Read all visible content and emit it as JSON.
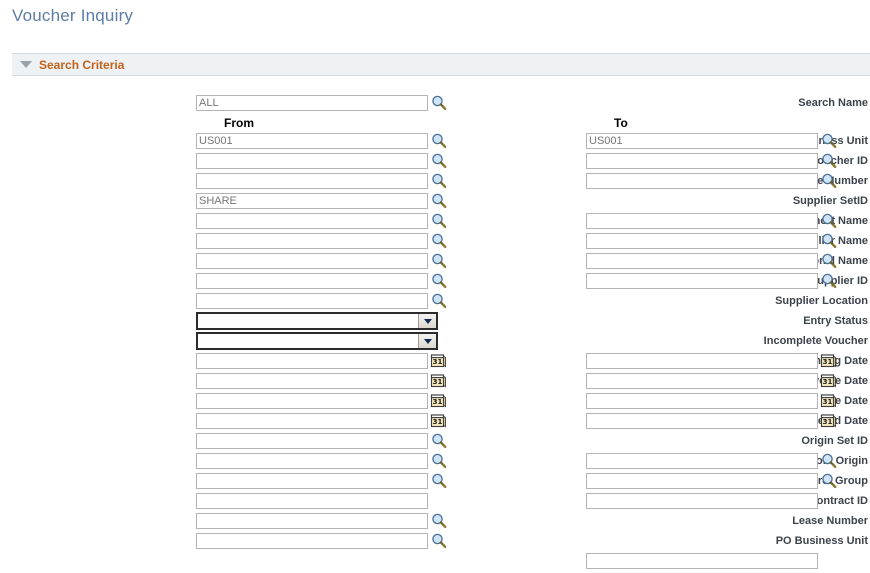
{
  "page": {
    "title": "Voucher Inquiry"
  },
  "criteria_section": {
    "header_label": "Search Criteria",
    "collapse_icon": "triangle-down-icon",
    "expanded": true
  },
  "search_name": {
    "label": "Search Name",
    "value": "ALL",
    "lookup_icon": "magnifier-icon"
  },
  "column_headers": {
    "from": "From",
    "to": "To"
  },
  "icons": {
    "lookup": "magnifier-icon",
    "calendar": "calendar-icon",
    "dropdown": "chevron-down-icon"
  },
  "colors": {
    "title": "#5b7da6",
    "section_header_text": "#c4611a",
    "section_header_bg": "#eff2f5",
    "label_text": "#3c434b",
    "field_border": "#b4b4b4",
    "field_value_text": "#777777",
    "calendar_icon": "#e8d9a8"
  },
  "fields": [
    {
      "label": "From Business Unit",
      "from": {
        "value": "US001",
        "icon": "magnifier-icon"
      },
      "to": {
        "value": "US001",
        "icon": "magnifier-icon"
      }
    },
    {
      "label": "From Voucher ID",
      "from": {
        "value": "",
        "icon": "magnifier-icon"
      },
      "to": {
        "value": "",
        "icon": "magnifier-icon"
      }
    },
    {
      "label": "From Invoice Number",
      "from": {
        "value": "",
        "icon": "magnifier-icon"
      },
      "to": {
        "value": "",
        "icon": "magnifier-icon"
      }
    },
    {
      "label": "Supplier SetID",
      "from": {
        "value": "SHARE",
        "icon": "magnifier-icon"
      },
      "to": null
    },
    {
      "label": "From Supplier Short Name",
      "from": {
        "value": "",
        "icon": "magnifier-icon"
      },
      "to": {
        "value": "",
        "icon": "magnifier-icon"
      }
    },
    {
      "label": "From Supplier Name",
      "from": {
        "value": "",
        "icon": "magnifier-icon"
      },
      "to": {
        "value": "",
        "icon": "magnifier-icon"
      }
    },
    {
      "label": "From Additional Name",
      "from": {
        "value": "",
        "icon": "magnifier-icon"
      },
      "to": {
        "value": "",
        "icon": "magnifier-icon"
      }
    },
    {
      "label": "From Supplier ID",
      "from": {
        "value": "",
        "icon": "magnifier-icon"
      },
      "to": {
        "value": "",
        "icon": "magnifier-icon"
      }
    },
    {
      "label": "Supplier Location",
      "from": {
        "value": "",
        "icon": "magnifier-icon"
      },
      "to": null
    },
    {
      "label": "Entry Status",
      "from": {
        "value": "",
        "icon": "chevron-down-icon",
        "control": "select"
      },
      "to": null
    },
    {
      "label": "Incomplete Voucher",
      "from": {
        "value": "",
        "icon": "chevron-down-icon",
        "control": "select"
      },
      "to": null
    },
    {
      "label": "From Accounting Date",
      "from": {
        "value": "",
        "icon": "calendar-icon"
      },
      "to": {
        "value": "",
        "icon": "calendar-icon"
      }
    },
    {
      "label": "From Invoice Date",
      "from": {
        "value": "",
        "icon": "calendar-icon"
      },
      "to": {
        "value": "",
        "icon": "calendar-icon"
      }
    },
    {
      "label": "From Due Date",
      "from": {
        "value": "",
        "icon": "calendar-icon"
      },
      "to": {
        "value": "",
        "icon": "calendar-icon"
      }
    },
    {
      "label": "From Entered Date",
      "from": {
        "value": "",
        "icon": "calendar-icon"
      },
      "to": {
        "value": "",
        "icon": "calendar-icon"
      }
    },
    {
      "label": "Origin Set ID",
      "from": {
        "value": "",
        "icon": "magnifier-icon"
      },
      "to": null
    },
    {
      "label": "From Origin",
      "from": {
        "value": "",
        "icon": "magnifier-icon"
      },
      "to": {
        "value": "",
        "icon": "magnifier-icon"
      }
    },
    {
      "label": "From Control Group",
      "from": {
        "value": "",
        "icon": "magnifier-icon"
      },
      "to": {
        "value": "",
        "icon": "magnifier-icon"
      }
    },
    {
      "label": "From Contract ID",
      "from": {
        "value": "",
        "icon": null
      },
      "to": {
        "value": "",
        "icon": null
      }
    },
    {
      "label": "Lease Number",
      "from": {
        "value": "",
        "icon": "magnifier-icon"
      },
      "to": null
    },
    {
      "label": "PO Business Unit",
      "from": {
        "value": "",
        "icon": "magnifier-icon"
      },
      "to": null
    }
  ]
}
